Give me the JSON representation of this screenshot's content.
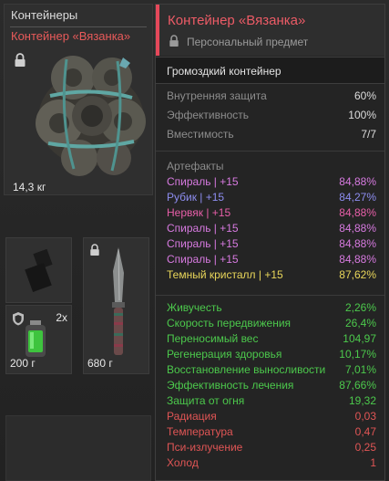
{
  "inventory": {
    "category_title": "Контейнеры",
    "item_name": "Контейнер «Вязанка»",
    "weight": "14,3 кг",
    "slot_stack_count": "2x",
    "slot_medkit_weight": "200 г",
    "slot_knife_weight": "680 г"
  },
  "tooltip": {
    "title": "Контейнер «Вязанка»",
    "subtitle": "Персональный предмет",
    "type": "Громоздкий контейнер",
    "stats": [
      {
        "label": "Внутренняя защита",
        "value": "60%"
      },
      {
        "label": "Эффективность",
        "value": "100%"
      },
      {
        "label": "Вместимость",
        "value": "7/7"
      }
    ],
    "artifacts_header": "Артефакты",
    "artifacts": [
      {
        "label": "Спираль | +15",
        "value": "84,88%",
        "color": "#d77ae0"
      },
      {
        "label": "Рубик | +15",
        "value": "84,27%",
        "color": "#8d8df0"
      },
      {
        "label": "Нервяк | +15",
        "value": "84,88%",
        "color": "#e85fa9"
      },
      {
        "label": "Спираль | +15",
        "value": "84,88%",
        "color": "#d77ae0"
      },
      {
        "label": "Спираль | +15",
        "value": "84,88%",
        "color": "#d77ae0"
      },
      {
        "label": "Спираль | +15",
        "value": "84,88%",
        "color": "#d77ae0"
      },
      {
        "label": "Темный кристалл | +15",
        "value": "87,62%",
        "color": "#e9d65a"
      }
    ],
    "positive_effects": [
      {
        "label": "Живучесть",
        "value": "2,26%"
      },
      {
        "label": "Скорость передвижения",
        "value": "26,4%"
      },
      {
        "label": "Переносимый вес",
        "value": "104,97"
      },
      {
        "label": "Регенерация здоровья",
        "value": "10,17%"
      },
      {
        "label": "Восстановление выносливости",
        "value": "7,01%"
      },
      {
        "label": "Эффективность лечения",
        "value": "87,66%"
      },
      {
        "label": "Защита от огня",
        "value": "19,32"
      }
    ],
    "negative_effects": [
      {
        "label": "Радиация",
        "value": "0,03"
      },
      {
        "label": "Температура",
        "value": "0,47"
      },
      {
        "label": "Пси-излучение",
        "value": "0,25"
      },
      {
        "label": "Холод",
        "value": "1"
      }
    ]
  },
  "colors": {
    "accent_red": "#e5485a",
    "positive_green": "#4cc94c",
    "negative_red": "#e05555"
  }
}
